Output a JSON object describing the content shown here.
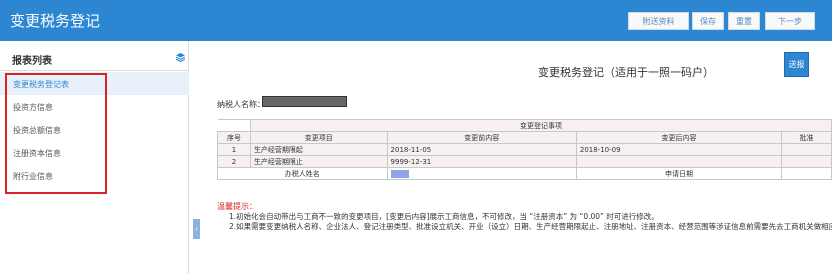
{
  "header": {
    "title": "变更税务登记",
    "buttons": [
      "附送资料",
      "保存",
      "重置",
      "下一步"
    ]
  },
  "sidebar": {
    "title": "报表列表",
    "items": [
      "变更税务登记表",
      "投资方信息",
      "投资总额信息",
      "注册资本信息",
      "附行业信息"
    ],
    "active_index": 0
  },
  "form": {
    "title": "变更税务登记（适用于一照一码户）",
    "send_label": "送报",
    "taxpayer_label": "纳税人名称：",
    "group_header": "变更登记事项",
    "columns": [
      "序号",
      "变更项目",
      "变更前内容",
      "变更后内容",
      "批准"
    ],
    "rows": [
      {
        "no": "1",
        "item": "生产经营期限起",
        "before": "2018-11-05",
        "after": "2018-10-09"
      },
      {
        "no": "2",
        "item": "生产经营期限止",
        "before": "9999-12-31",
        "after": ""
      }
    ],
    "agent_label": "办税人姓名",
    "date_label": "申请日期"
  },
  "tips": {
    "title": "温馨提示：",
    "line1": "1.初始化会自动带出与工商不一致的变更项目，[变更后内容]展示工商信息，不可修改，当 “注册资本” 为 “0.00” 时可进行修改。",
    "line2": "2.如果需要变更纳税人名称、企业法人、登记注册类型、批准设立机关、开业（设立）日期、生产经营期限起止、注册地址、注册资本、经营范围等涉证信息前需要先去工商机关做相应"
  },
  "colors": {
    "header_bg": "#2c86d2",
    "highlight": "#d9232b",
    "table_bg": "#f7f0f0"
  }
}
